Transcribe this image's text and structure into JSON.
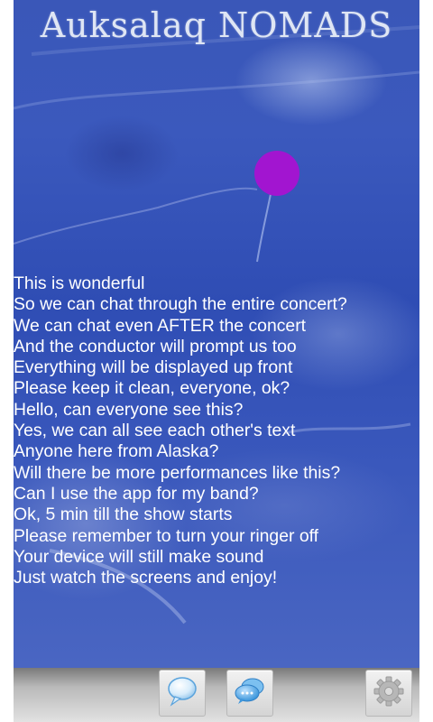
{
  "app": {
    "title": "Auksalaq NOMADS"
  },
  "indicator": {
    "color": "#a215d0"
  },
  "messages": [
    "This is wonderful",
    "So we can chat through the entire concert?",
    "We can chat even AFTER the concert",
    "And the conductor will prompt us too",
    "Everything will be displayed up front",
    "Please keep it clean, everyone, ok?",
    "Hello, can everyone see this?",
    "Yes, we can all see each other's text",
    "Anyone here from Alaska?",
    "Will there be more performances like this?",
    "Can I use the app for my band?",
    "Ok, 5 min till the show starts",
    "Please remember to turn your ringer off",
    "Your device will still make sound",
    "Just watch the screens and enjoy!"
  ],
  "toolbar": {
    "buttons": [
      {
        "icon": "chat-bubble-icon"
      },
      {
        "icon": "chat-bubbles-icon"
      },
      {
        "icon": "gear-icon"
      }
    ]
  }
}
